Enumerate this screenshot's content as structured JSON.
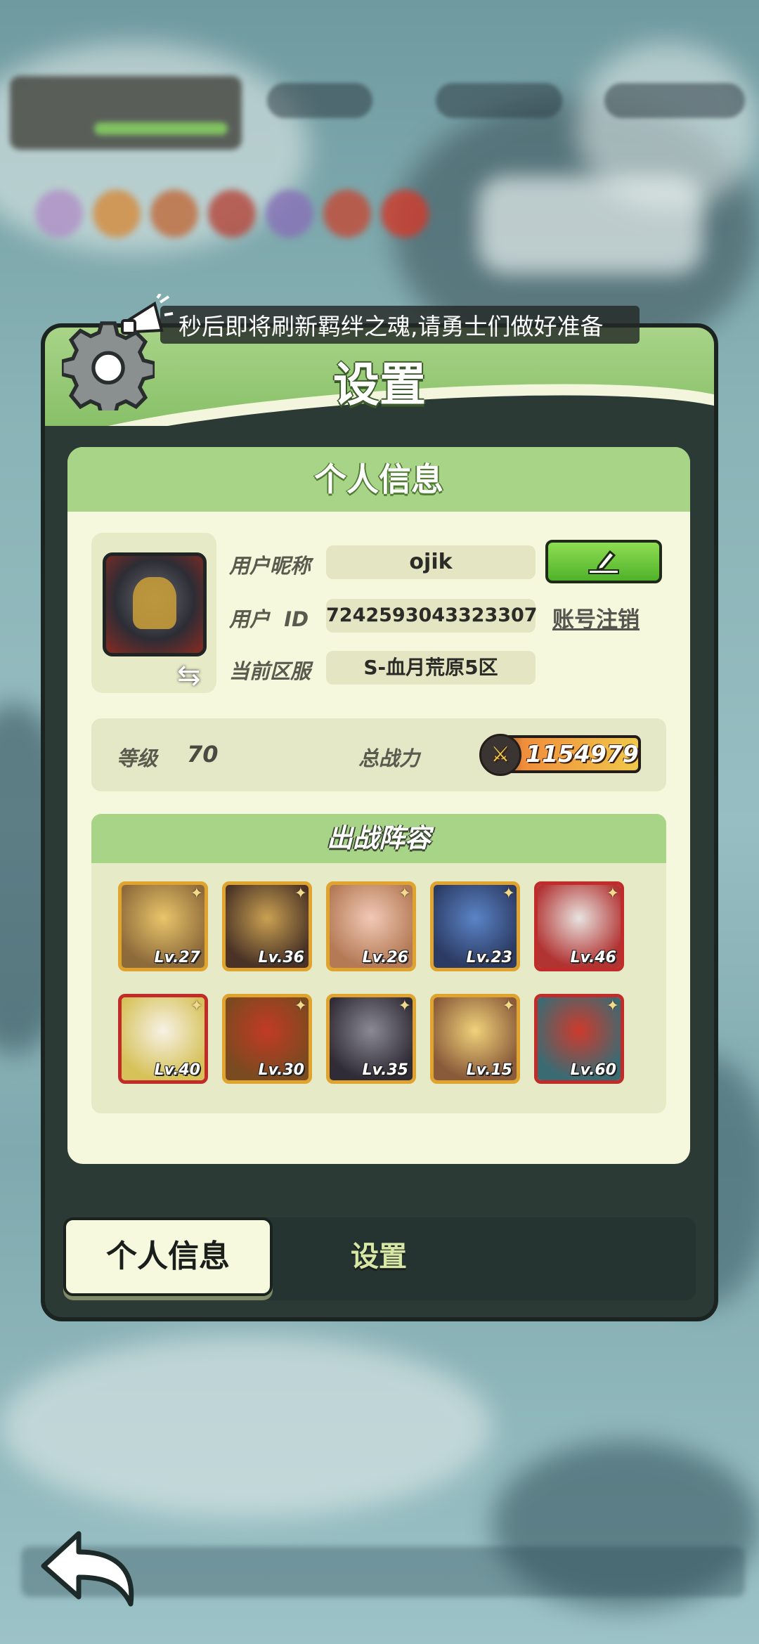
{
  "announcement": {
    "text": "秒后即将刷新羁绊之魂,请勇士们做好准备"
  },
  "dialog": {
    "title": "设置"
  },
  "profile": {
    "section_title": "个人信息",
    "nickname_label": "用户昵称",
    "nickname": "ojik",
    "id_label": "用户  ID",
    "user_id": "7242593043323307",
    "server_label": "当前区服",
    "server": "S-血月荒原5区",
    "cancel_account": "账号注销",
    "level_label": "等级",
    "level": "70",
    "power_label": "总战力",
    "power": "1154979"
  },
  "lineup": {
    "title": "出战阵容",
    "heroes": [
      {
        "level": "Lv.27",
        "frame": "gold",
        "colors": [
          "#e9c56b",
          "#8d6a3a"
        ]
      },
      {
        "level": "Lv.36",
        "frame": "gold",
        "colors": [
          "#caa152",
          "#4a3326"
        ]
      },
      {
        "level": "Lv.26",
        "frame": "gold",
        "colors": [
          "#f2c9b6",
          "#b47a56"
        ]
      },
      {
        "level": "Lv.23",
        "frame": "gold",
        "colors": [
          "#5b84c7",
          "#2b3b63"
        ]
      },
      {
        "level": "Lv.46",
        "frame": "red",
        "colors": [
          "#e8e3df",
          "#b13332"
        ]
      },
      {
        "level": "Lv.40",
        "frame": "red",
        "colors": [
          "#f6f2e6",
          "#d7c25a"
        ]
      },
      {
        "level": "Lv.30",
        "frame": "gold",
        "colors": [
          "#c23a24",
          "#7a4a20"
        ]
      },
      {
        "level": "Lv.35",
        "frame": "gold",
        "colors": [
          "#8b8a93",
          "#2f2b37"
        ]
      },
      {
        "level": "Lv.15",
        "frame": "gold",
        "colors": [
          "#f0d27a",
          "#8a5b3a"
        ]
      },
      {
        "level": "Lv.60",
        "frame": "red",
        "colors": [
          "#cf3a2c",
          "#3a6b73"
        ]
      }
    ]
  },
  "tabs": {
    "active": "个人信息",
    "other": "设置"
  },
  "icons": {
    "gear": "gear-icon",
    "megaphone": "megaphone-icon",
    "edit": "pencil-icon",
    "swap": "swap-icon",
    "power": "swords-icon",
    "back": "back-arrow-icon"
  },
  "colors": {
    "accent_green": "#88c068",
    "panel": "#f6f8dd",
    "dialog_dark": "#2b3a35"
  }
}
